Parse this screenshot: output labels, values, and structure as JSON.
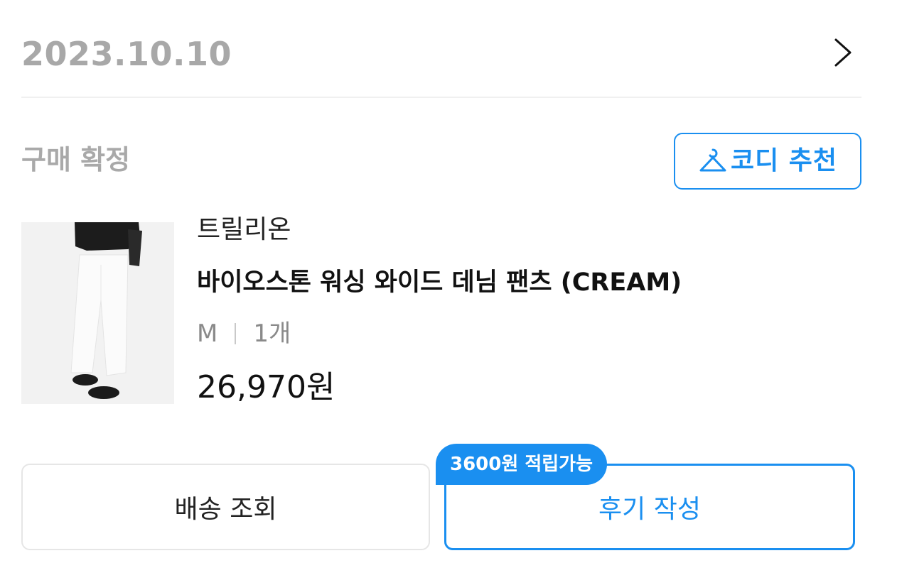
{
  "order": {
    "date": "2023.10.10"
  },
  "status": {
    "label": "구매 확정",
    "codi_button_label": "코디 추천"
  },
  "product": {
    "brand": "트릴리온",
    "name": "바이오스톤 워싱 와이드 데님 팬츠 (CREAM)",
    "size": "M",
    "quantity": "1개",
    "price": "26,970원"
  },
  "actions": {
    "delivery_label": "배송 조회",
    "review_label": "후기 작성",
    "reward_badge": "3600원 적립가능"
  },
  "colors": {
    "accent": "#1a8ff0",
    "muted_text": "#a8a8a8"
  },
  "icons": {
    "chevron": "chevron-right-icon",
    "codi": "hanger-icon"
  }
}
